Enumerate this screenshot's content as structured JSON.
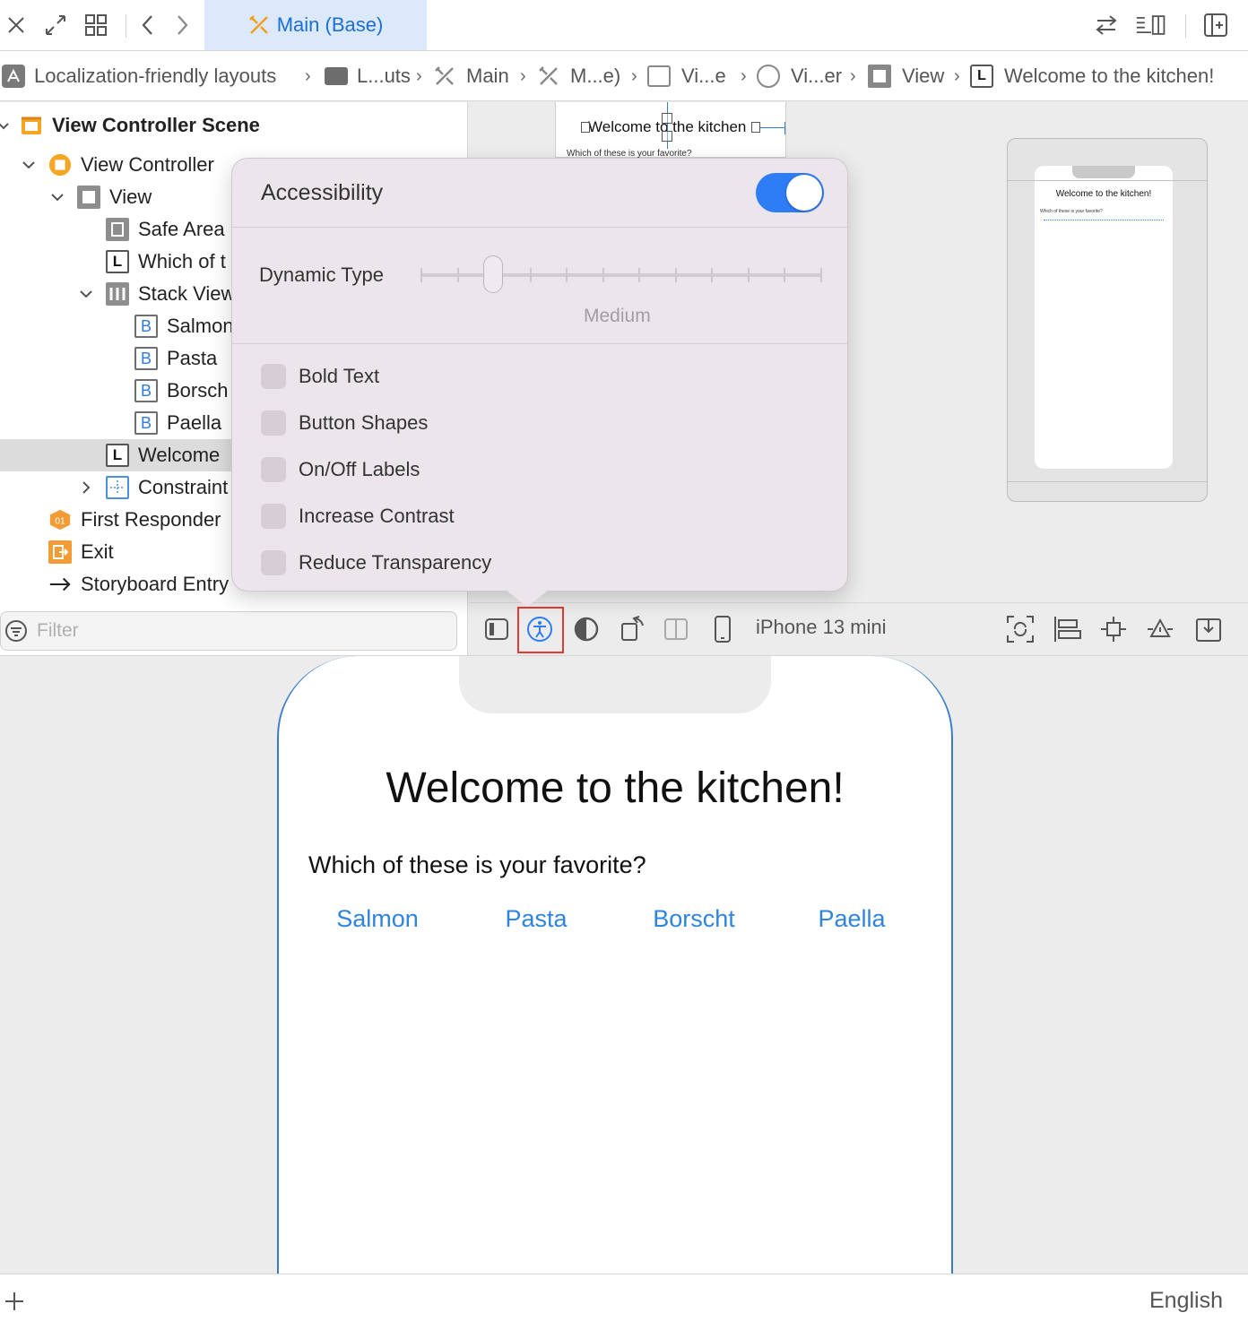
{
  "tabbar": {
    "active_tab": "Main (Base)"
  },
  "jumpbar": {
    "crumbs": [
      "Localization-friendly layouts",
      "L...uts",
      "Main",
      "M...e)",
      "Vi...e",
      "Vi...er",
      "View",
      "Welcome to the kitchen!"
    ]
  },
  "outline": {
    "items": [
      {
        "label": "View Controller Scene",
        "icon": "scene-icon"
      },
      {
        "label": "View Controller",
        "icon": "view-controller-icon"
      },
      {
        "label": "View",
        "icon": "view-icon"
      },
      {
        "label": "Safe Area",
        "icon": "safe-area-icon"
      },
      {
        "label": "Which of t",
        "icon": "label-icon"
      },
      {
        "label": "Stack View",
        "icon": "stack-view-icon"
      },
      {
        "label": "Salmon",
        "icon": "button-icon"
      },
      {
        "label": "Pasta",
        "icon": "button-icon"
      },
      {
        "label": "Borsch",
        "icon": "button-icon"
      },
      {
        "label": "Paella",
        "icon": "button-icon"
      },
      {
        "label": "Welcome",
        "icon": "label-icon"
      },
      {
        "label": "Constraint",
        "icon": "constraints-icon"
      },
      {
        "label": "First Responder",
        "icon": "first-responder-icon"
      },
      {
        "label": "Exit",
        "icon": "exit-icon"
      },
      {
        "label": "Storyboard Entry",
        "icon": "entry-arrow-icon"
      }
    ],
    "filter_placeholder": "Filter"
  },
  "mini_scene": {
    "title": "Welcome to the kitchen",
    "subtitle": "Which of these is your favorite?"
  },
  "preview": {
    "title": "Welcome to the kitchen!",
    "subtitle": "Which of these is your favorite?"
  },
  "popover": {
    "title": "Accessibility",
    "toggle_on": true,
    "dynamic_type_label": "Dynamic Type",
    "dynamic_type_value": "Medium",
    "dynamic_type_step": 2,
    "dynamic_type_steps": 12,
    "options": [
      "Bold Text",
      "Button Shapes",
      "On/Off Labels",
      "Increase Contrast",
      "Reduce Transparency"
    ]
  },
  "canvas_toolbar": {
    "device": "iPhone 13 mini"
  },
  "canvas": {
    "title": "Welcome to the kitchen!",
    "question": "Which of these is your favorite?",
    "choices": [
      "Salmon",
      "Pasta",
      "Borscht",
      "Paella"
    ]
  },
  "bottombar": {
    "language": "English"
  },
  "colors": {
    "accent": "#2f84dd",
    "toggle": "#2e7cf6",
    "highlight_box": "#e53935"
  }
}
